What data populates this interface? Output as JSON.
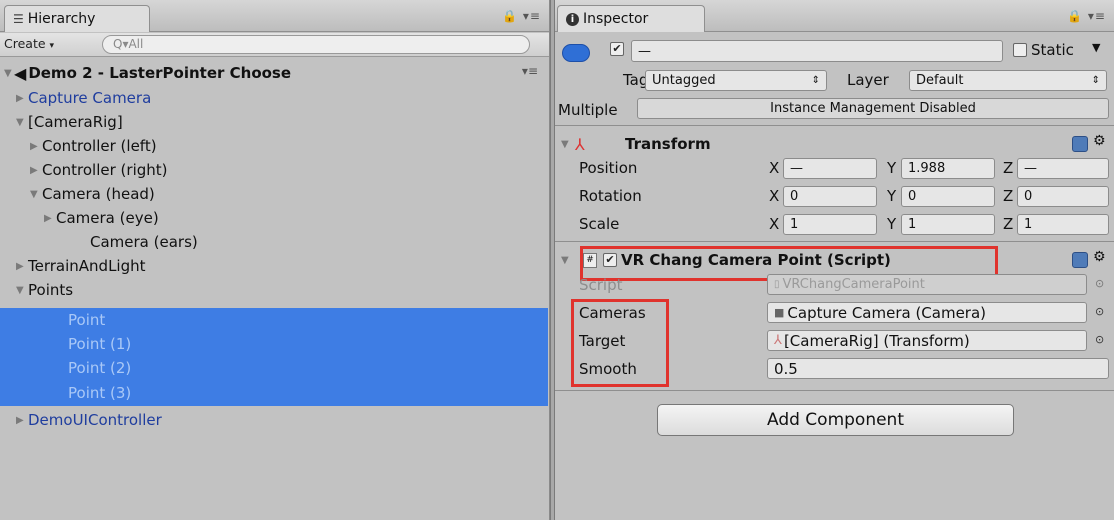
{
  "hierarchy": {
    "tab_label": "Hierarchy",
    "create_label": "Create",
    "search_placeholder": "All",
    "scene_name": "Demo 2 - LasterPointer Choose",
    "items": [
      {
        "label": "Capture Camera",
        "arrow": "▶",
        "selected": false
      },
      {
        "label": "[CameraRig]",
        "arrow": "▼",
        "selected": false
      },
      {
        "label": "Controller (left)",
        "arrow": "▶",
        "selected": false
      },
      {
        "label": "Controller (right)",
        "arrow": "▶",
        "selected": false
      },
      {
        "label": "Camera (head)",
        "arrow": "▼",
        "selected": false
      },
      {
        "label": "Camera (eye)",
        "arrow": "▶",
        "selected": false
      },
      {
        "label": "Camera (ears)",
        "arrow": "",
        "selected": false
      },
      {
        "label": "TerrainAndLight",
        "arrow": "▶",
        "selected": false
      },
      {
        "label": "Points",
        "arrow": "▼",
        "selected": false
      },
      {
        "label": "Point",
        "arrow": "",
        "selected": true
      },
      {
        "label": "Point (1)",
        "arrow": "",
        "selected": true
      },
      {
        "label": "Point (2)",
        "arrow": "",
        "selected": true
      },
      {
        "label": "Point (3)",
        "arrow": "",
        "selected": true
      },
      {
        "label": "DemoUIController",
        "arrow": "▶",
        "selected": false
      }
    ]
  },
  "inspector": {
    "tab_label": "Inspector",
    "name_value": "—",
    "static_label": "Static",
    "tag_label": "Tag",
    "tag_value": "Untagged",
    "layer_label": "Layer",
    "layer_value": "Default",
    "multiple_label": "Multiple",
    "instance_management": "Instance Management Disabled",
    "transform": {
      "title": "Transform",
      "position_label": "Position",
      "rotation_label": "Rotation",
      "scale_label": "Scale",
      "axis_x": "X",
      "axis_y": "Y",
      "axis_z": "Z",
      "position": {
        "x": "—",
        "y": "1.988",
        "z": "—"
      },
      "rotation": {
        "x": "0",
        "y": "0",
        "z": "0"
      },
      "scale": {
        "x": "1",
        "y": "1",
        "z": "1"
      }
    },
    "script_component": {
      "title": "VR Chang Camera Point (Script)",
      "script_label": "Script",
      "script_value": "VRChangCameraPoint",
      "cameras_label": "Cameras",
      "cameras_value": "Capture Camera (Camera)",
      "target_label": "Target",
      "target_value": "[CameraRig] (Transform)",
      "smooth_label": "Smooth",
      "smooth_value": "0.5"
    },
    "add_component_label": "Add Component"
  },
  "colors": {
    "selection": "#3e7de4",
    "highlight_box": "#e0332d",
    "object_blue": "#1f3d9e"
  }
}
